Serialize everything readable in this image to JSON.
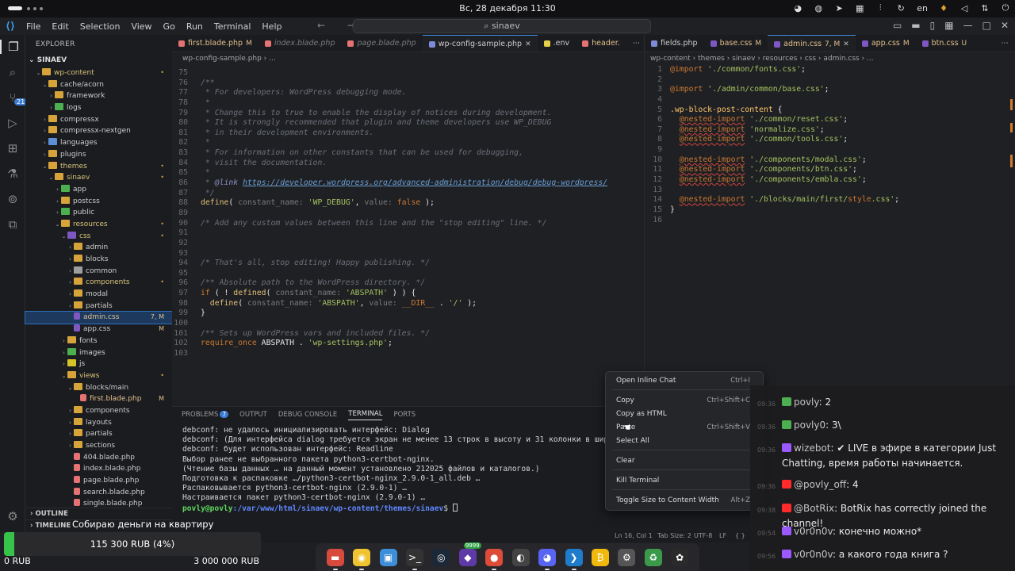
{
  "system_bar": {
    "clock": "Вс, 28 декабря  11:30",
    "lang": "en"
  },
  "window": {
    "menu": [
      "File",
      "Edit",
      "Selection",
      "View",
      "Go",
      "Run",
      "Terminal",
      "Help"
    ],
    "search_text": "sinaev"
  },
  "explorer": {
    "header": "EXPLORER",
    "root": "SINAEV",
    "outline_label": "OUTLINE",
    "timeline_label": "TIMELINE",
    "items": [
      {
        "label": "wp-content",
        "depth": 1,
        "kind": "folder-open",
        "color": "#d6a43a",
        "status": "•",
        "status_color": "#c9a44a",
        "label_color": "#d6c27a"
      },
      {
        "label": "cache/acorn",
        "depth": 2,
        "kind": "folder-open",
        "color": "#d6a43a",
        "status": "",
        "status_color": "",
        "label_color": "#cccccc"
      },
      {
        "label": "framework",
        "depth": 3,
        "kind": "folder",
        "color": "#d6a43a",
        "status": "",
        "status_color": "",
        "label_color": "#cccccc"
      },
      {
        "label": "logs",
        "depth": 3,
        "kind": "folder",
        "color": "#4caf50",
        "status": "",
        "status_color": "",
        "label_color": "#cccccc"
      },
      {
        "label": "compressx",
        "depth": 2,
        "kind": "folder",
        "color": "#d6a43a",
        "status": "",
        "status_color": "",
        "label_color": "#cccccc"
      },
      {
        "label": "compressx-nextgen",
        "depth": 2,
        "kind": "folder",
        "color": "#d6a43a",
        "status": "",
        "status_color": "",
        "label_color": "#cccccc"
      },
      {
        "label": "languages",
        "depth": 2,
        "kind": "folder",
        "color": "#5b8fd6",
        "status": "",
        "status_color": "",
        "label_color": "#cccccc"
      },
      {
        "label": "plugins",
        "depth": 2,
        "kind": "folder",
        "color": "#d6a43a",
        "status": "",
        "status_color": "",
        "label_color": "#cccccc"
      },
      {
        "label": "themes",
        "depth": 2,
        "kind": "folder-open",
        "color": "#d6a43a",
        "status": "•",
        "status_color": "#c9a44a",
        "label_color": "#d6c27a"
      },
      {
        "label": "sinaev",
        "depth": 3,
        "kind": "folder-open",
        "color": "#d6a43a",
        "status": "•",
        "status_color": "#c9a44a",
        "label_color": "#d6c27a"
      },
      {
        "label": "app",
        "depth": 4,
        "kind": "folder",
        "color": "#4caf50",
        "status": "",
        "status_color": "",
        "label_color": "#cccccc"
      },
      {
        "label": "postcss",
        "depth": 4,
        "kind": "folder",
        "color": "#d6a43a",
        "status": "",
        "status_color": "",
        "label_color": "#cccccc"
      },
      {
        "label": "public",
        "depth": 4,
        "kind": "folder",
        "color": "#4caf50",
        "status": "",
        "status_color": "",
        "label_color": "#cccccc"
      },
      {
        "label": "resources",
        "depth": 4,
        "kind": "folder-open",
        "color": "#d6a43a",
        "status": "•",
        "status_color": "#c9a44a",
        "label_color": "#d6c27a"
      },
      {
        "label": "css",
        "depth": 5,
        "kind": "folder-open",
        "color": "#7e57c2",
        "status": "•",
        "status_color": "#c9a44a",
        "label_color": "#d6c27a"
      },
      {
        "label": "admin",
        "depth": 6,
        "kind": "folder",
        "color": "#d6a43a",
        "status": "",
        "status_color": "",
        "label_color": "#cccccc"
      },
      {
        "label": "blocks",
        "depth": 6,
        "kind": "folder",
        "color": "#d6a43a",
        "status": "",
        "status_color": "",
        "label_color": "#cccccc"
      },
      {
        "label": "common",
        "depth": 6,
        "kind": "folder",
        "color": "#9e9e9e",
        "status": "",
        "status_color": "",
        "label_color": "#cccccc"
      },
      {
        "label": "components",
        "depth": 6,
        "kind": "folder",
        "color": "#d6a43a",
        "status": "•",
        "status_color": "#c9a44a",
        "label_color": "#d6c27a"
      },
      {
        "label": "modal",
        "depth": 6,
        "kind": "folder",
        "color": "#d6a43a",
        "status": "",
        "status_color": "",
        "label_color": "#cccccc"
      },
      {
        "label": "partials",
        "depth": 6,
        "kind": "folder",
        "color": "#d6a43a",
        "status": "",
        "status_color": "",
        "label_color": "#cccccc"
      },
      {
        "label": "admin.css",
        "depth": 6,
        "kind": "file",
        "color": "#7e57c2",
        "status": "7, M",
        "status_color": "#e2c08d",
        "label_color": "#e2c08d",
        "selected": true
      },
      {
        "label": "app.css",
        "depth": 6,
        "kind": "file",
        "color": "#7e57c2",
        "status": "M",
        "status_color": "#e2c08d",
        "label_color": "#cccccc"
      },
      {
        "label": "fonts",
        "depth": 5,
        "kind": "folder",
        "color": "#d6a43a",
        "status": "",
        "status_color": "",
        "label_color": "#cccccc"
      },
      {
        "label": "images",
        "depth": 5,
        "kind": "folder",
        "color": "#4caf50",
        "status": "",
        "status_color": "",
        "label_color": "#cccccc"
      },
      {
        "label": "js",
        "depth": 5,
        "kind": "folder",
        "color": "#d6c22a",
        "status": "",
        "status_color": "",
        "label_color": "#cccccc"
      },
      {
        "label": "views",
        "depth": 5,
        "kind": "folder-open",
        "color": "#d6a43a",
        "status": "•",
        "status_color": "#c9a44a",
        "label_color": "#d6c27a"
      },
      {
        "label": "blocks/main",
        "depth": 6,
        "kind": "folder-open",
        "color": "#d6a43a",
        "status": "",
        "status_color": "",
        "label_color": "#cccccc"
      },
      {
        "label": "first.blade.php",
        "depth": 7,
        "kind": "file",
        "color": "#e57373",
        "status": "M",
        "status_color": "#e2c08d",
        "label_color": "#e2c08d"
      },
      {
        "label": "components",
        "depth": 6,
        "kind": "folder",
        "color": "#d6a43a",
        "status": "",
        "status_color": "",
        "label_color": "#cccccc"
      },
      {
        "label": "layouts",
        "depth": 6,
        "kind": "folder",
        "color": "#d6a43a",
        "status": "",
        "status_color": "",
        "label_color": "#cccccc"
      },
      {
        "label": "partials",
        "depth": 6,
        "kind": "folder",
        "color": "#d6a43a",
        "status": "",
        "status_color": "",
        "label_color": "#cccccc"
      },
      {
        "label": "sections",
        "depth": 6,
        "kind": "folder",
        "color": "#d6a43a",
        "status": "",
        "status_color": "",
        "label_color": "#cccccc"
      },
      {
        "label": "404.blade.php",
        "depth": 6,
        "kind": "file",
        "color": "#e57373",
        "status": "",
        "status_color": "",
        "label_color": "#cccccc"
      },
      {
        "label": "index.blade.php",
        "depth": 6,
        "kind": "file",
        "color": "#e57373",
        "status": "",
        "status_color": "",
        "label_color": "#cccccc"
      },
      {
        "label": "page.blade.php",
        "depth": 6,
        "kind": "file",
        "color": "#e57373",
        "status": "",
        "status_color": "",
        "label_color": "#cccccc"
      },
      {
        "label": "search.blade.php",
        "depth": 6,
        "kind": "file",
        "color": "#e57373",
        "status": "",
        "status_color": "",
        "label_color": "#cccccc"
      },
      {
        "label": "single.blade.php",
        "depth": 6,
        "kind": "file",
        "color": "#e57373",
        "status": "",
        "status_color": "",
        "label_color": "#cccccc"
      }
    ]
  },
  "left_editor": {
    "tabs": [
      {
        "label": "first.blade.php",
        "mod": "M",
        "color": "#e57373",
        "active": false,
        "label_color": "#e2c08d"
      },
      {
        "label": "index.blade.php",
        "mod": "",
        "color": "#e57373",
        "active": false,
        "label_color": "#7c7c7c"
      },
      {
        "label": "page.blade.php",
        "mod": "",
        "color": "#e57373",
        "active": false,
        "label_color": "#7c7c7c"
      },
      {
        "label": "wp-config-sample.php",
        "mod": "",
        "color": "#7e8bd8",
        "active": true,
        "label_color": "#cccccc"
      },
      {
        "label": ".env",
        "mod": "",
        "color": "#e6d04a",
        "active": false,
        "label_color": "#cccccc"
      },
      {
        "label": "header.",
        "mod": "",
        "color": "#e57373",
        "active": false,
        "label_color": "#e2c08d"
      }
    ],
    "breadcrumb": "wp-config-sample.php › ...",
    "lines": [
      {
        "n": "75",
        "html": ""
      },
      {
        "n": "76",
        "html": "<span class='cmt'>/**</span>"
      },
      {
        "n": "77",
        "html": "<span class='cmt'> * For developers: WordPress debugging mode.</span>"
      },
      {
        "n": "78",
        "html": "<span class='cmt'> *</span>"
      },
      {
        "n": "79",
        "html": "<span class='cmt'> * Change this to true to enable the display of notices during development.</span>"
      },
      {
        "n": "80",
        "html": "<span class='cmt'> * It is strongly recommended that plugin and theme developers use WP_DEBUG</span>"
      },
      {
        "n": "81",
        "html": "<span class='cmt'> * in their development environments.</span>"
      },
      {
        "n": "82",
        "html": "<span class='cmt'> *</span>"
      },
      {
        "n": "83",
        "html": "<span class='cmt'> * For information on other constants that can be used for debugging,</span>"
      },
      {
        "n": "84",
        "html": "<span class='cmt'> * visit the documentation.</span>"
      },
      {
        "n": "85",
        "html": "<span class='cmt'> *</span>"
      },
      {
        "n": "86",
        "html": "<span class='cmt'> * </span><span class='cmt' style='color:#8a92c9'>@link</span> <span class='lnk'>https://developer.wordpress.org/advanced-administration/debug/debug-wordpress/</span>"
      },
      {
        "n": "87",
        "html": "<span class='cmt'> */</span>"
      },
      {
        "n": "88",
        "html": "<span class='fn'>define</span>( <span class='par'>constant_name:</span> <span class='str'>'WP_DEBUG'</span>, <span class='par'>value:</span> <span class='kw'>false</span> );"
      },
      {
        "n": "89",
        "html": ""
      },
      {
        "n": "90",
        "html": "<span class='cmt'>/* Add any custom values between this line and the \"stop editing\" line. */</span>"
      },
      {
        "n": "91",
        "html": ""
      },
      {
        "n": "92",
        "html": ""
      },
      {
        "n": "93",
        "html": ""
      },
      {
        "n": "94",
        "html": "<span class='cmt'>/* That's all, stop editing! Happy publishing. */</span>"
      },
      {
        "n": "95",
        "html": ""
      },
      {
        "n": "96",
        "html": "<span class='cmt'>/** Absolute path to the WordPress directory. */</span>"
      },
      {
        "n": "97",
        "html": "<span class='kw'>if</span> ( ! <span class='fn'>defined</span>( <span class='par'>constant_name:</span> <span class='str'>'ABSPATH'</span> ) ) {"
      },
      {
        "n": "98",
        "html": "  <span class='fn'>define</span>( <span class='par'>constant_name:</span> <span class='str'>'ABSPATH'</span>, <span class='par'>value:</span> <span class='kw'>__DIR__</span> . <span class='str'>'/'</span> );"
      },
      {
        "n": "99",
        "html": "}"
      },
      {
        "n": "100",
        "html": ""
      },
      {
        "n": "101",
        "html": "<span class='cmt'>/** Sets up WordPress vars and included files. */</span>"
      },
      {
        "n": "102",
        "html": "<span class='kw'>require_once</span> ABSPATH . <span class='str'>'wp-settings.php'</span>;"
      },
      {
        "n": "103",
        "html": ""
      }
    ]
  },
  "right_editor": {
    "tabs": [
      {
        "label": "fields.php",
        "mod": "",
        "color": "#7e8bd8",
        "active": false,
        "label_color": "#cccccc"
      },
      {
        "label": "base.css",
        "mod": "M",
        "color": "#7e57c2",
        "active": false,
        "label_color": "#e2c08d"
      },
      {
        "label": "admin.css",
        "mod": "7, M",
        "color": "#7e57c2",
        "active": true,
        "label_color": "#e2c08d"
      },
      {
        "label": "app.css",
        "mod": "M",
        "color": "#7e57c2",
        "active": false,
        "label_color": "#e2c08d"
      },
      {
        "label": "btn.css",
        "mod": "U",
        "color": "#7e57c2",
        "active": false,
        "label_color": "#e2c08d"
      }
    ],
    "breadcrumb": "wp-content › themes › sinaev › resources › css › admin.css › ...",
    "lines": [
      {
        "n": "1",
        "html": "<span class='at'>@import</span> <span class='str'>'./common/fonts.css'</span>;"
      },
      {
        "n": "2",
        "html": ""
      },
      {
        "n": "3",
        "html": "<span class='at'>@import</span> <span class='str'>'./admin/common/base.css'</span>;"
      },
      {
        "n": "4",
        "html": ""
      },
      {
        "n": "5",
        "html": "<span class='tag'>.wp-block-post-content</span> {"
      },
      {
        "n": "6",
        "html": "  <span class='squig'>@nested-import</span> <span class='str'>'./common/reset.css'</span>;"
      },
      {
        "n": "7",
        "html": "  <span class='squig'>@nested-import</span> <span class='str'>'normalize.css'</span>;"
      },
      {
        "n": "8",
        "html": "  <span class='squig'>@nested-import</span> <span class='str'>'./common/tools.css'</span>;"
      },
      {
        "n": "9",
        "html": ""
      },
      {
        "n": "10",
        "html": "  <span class='squig'>@nested-import</span> <span class='str'>'./components/modal.css'</span>;"
      },
      {
        "n": "11",
        "html": "  <span class='squig'>@nested-import</span> <span class='str'>'./components/btn.css'</span>;"
      },
      {
        "n": "12",
        "html": "  <span class='squig'>@nested-import</span> <span class='str'>'./components/embla.css'</span>;"
      },
      {
        "n": "13",
        "html": ""
      },
      {
        "n": "14",
        "html": "  <span class='squig'>@nested-import</span> <span class='str'>'./blocks/main/first/</span><span class='at'>style</span><span class='str'>.css'</span>;"
      },
      {
        "n": "15",
        "html": "}"
      },
      {
        "n": "16",
        "html": ""
      }
    ]
  },
  "panel": {
    "tabs": [
      "PROBLEMS",
      "OUTPUT",
      "DEBUG CONSOLE",
      "TERMINAL",
      "PORTS"
    ],
    "problems_count": "7",
    "terminal_lines": [
      "debconf: не удалось инициализировать интерфейс: Dialog",
      "debconf: (Для интерфейса dialog требуется экран не менее 13 строк в высоту и 31 колонки в ширину.)",
      "debconf: будет использован интерфейс: Readline",
      "Выбор ранее не выбранного пакета python3-certbot-nginx.",
      "(Чтение базы данных … на данный момент установлено 212025 файлов и каталогов.)",
      "Подготовка к распаковке …/python3-certbot-nginx_2.9.0-1_all.deb …",
      "Распаковывается python3-certbot-nginx (2.9.0-1) …",
      "Настраивается пакет python3-certbot-nginx (2.9.0-1) …"
    ],
    "prompt_user": "povly@povly",
    "prompt_path": ":/var/www/html/sinaev/wp-content/themes/sinaev",
    "prompt_suffix": "$ "
  },
  "statusbar": {
    "position": "Ln 16, Col 1",
    "tab_size": "Tab Size: 2",
    "encoding": "UTF-8",
    "eol": "LF",
    "lang": "{ }"
  },
  "context_menu": {
    "items": [
      {
        "label": "Open Inline Chat",
        "shortcut": "Ctrl+I"
      },
      {
        "label": "Copy",
        "shortcut": "Ctrl+Shift+C"
      },
      {
        "label": "Copy as HTML",
        "shortcut": ""
      },
      {
        "label": "Paste",
        "shortcut": "Ctrl+Shift+V"
      },
      {
        "label": "Select All",
        "shortcut": ""
      },
      {
        "label": "Clear",
        "shortcut": ""
      },
      {
        "label": "Kill Terminal",
        "shortcut": ""
      },
      {
        "label": "Toggle Size to Content Width",
        "shortcut": "Alt+Z"
      }
    ]
  },
  "chat": {
    "messages": [
      {
        "ts": "09:36",
        "icon_color": "#4caf50",
        "name": "povly",
        "text": ": 2"
      },
      {
        "ts": "09:36",
        "icon_color": "#4caf50",
        "name": "povly0",
        "text": ": 3\\"
      },
      {
        "ts": "09:36",
        "icon_color": "#9b59ff",
        "name": "wizebot",
        "text": ": ✔ LIVE в эфире в категории Just Chatting, время работы начинается."
      },
      {
        "ts": "09:36",
        "icon_color": "#ff2a2a",
        "name": "@povly_off",
        "text": ": 4"
      },
      {
        "ts": "09:38",
        "icon_color": "#ff2a2a",
        "name": "@BotRix",
        "text": ": BotRix has correctly joined the channel!"
      },
      {
        "ts": "09:54",
        "icon_color": "#9b59ff",
        "name": "v0r0n0v",
        "text": ": конечно можно*"
      },
      {
        "ts": "09:56",
        "icon_color": "#9b59ff",
        "name": "v0r0n0v",
        "text": ": а какого года книга ?"
      }
    ]
  },
  "donation": {
    "goal": "Собираю деньги на квартиру",
    "amount": "115 300 RUB (4%)",
    "progress_percent": 4,
    "min": "0 RUB",
    "max": "3 000 000 RUB",
    "fill_color": "#37c24a"
  },
  "dock": {
    "apps": [
      {
        "name": "files-icon",
        "glyph": "▬",
        "bg": "#d84a3c"
      },
      {
        "name": "obs-icon",
        "glyph": "◉",
        "bg": "#f0c330"
      },
      {
        "name": "store-icon",
        "glyph": "▣",
        "bg": "#3d8ed8"
      },
      {
        "name": "terminal-icon",
        "glyph": ">_",
        "bg": "#333333"
      },
      {
        "name": "steam-icon",
        "glyph": "◎",
        "bg": "#1b2838"
      },
      {
        "name": "obsidian-icon",
        "glyph": "◆",
        "bg": "#5e3aa6"
      },
      {
        "name": "chrome-icon",
        "glyph": "●",
        "bg": "#dd4b39"
      },
      {
        "name": "browser-icon",
        "glyph": "◐",
        "bg": "#444444"
      },
      {
        "name": "discord-icon",
        "glyph": "◕",
        "bg": "#5865f2"
      },
      {
        "name": "vscode-icon",
        "glyph": "❯",
        "bg": "#1e7ccb"
      },
      {
        "name": "bitcoin-icon",
        "glyph": "₿",
        "bg": "#f0b90b"
      },
      {
        "name": "settings-icon",
        "glyph": "⚙",
        "bg": "#555555"
      },
      {
        "name": "recycle-icon",
        "glyph": "♻",
        "bg": "#3a9a4a"
      },
      {
        "name": "apps-icon",
        "glyph": "✿",
        "bg": "#2a2a2a"
      }
    ],
    "badge": "9999"
  }
}
